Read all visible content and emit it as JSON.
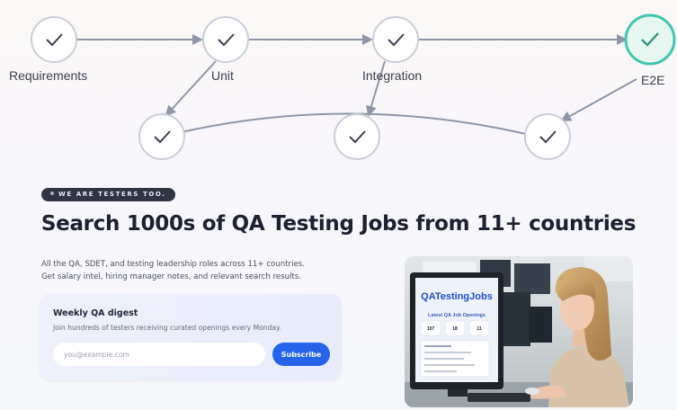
{
  "flow": {
    "stages": [
      {
        "label": "Requirements"
      },
      {
        "label": "Unit"
      },
      {
        "label": "Integration"
      },
      {
        "label": "E2E"
      }
    ]
  },
  "hero": {
    "badge": "WE ARE TESTERS TOO.",
    "headline": "Search 1000s of QA Testing Jobs from 11+ countries",
    "intro_line1": "All the QA, SDET, and testing leadership roles across 11+ countries.",
    "intro_line2": "Get salary intel, hiring manager notes, and relevant search results."
  },
  "newsletter": {
    "title": "Weekly QA digest",
    "subtitle": "Join hundreds of testers receiving curated openings every Monday.",
    "email_placeholder": "you@example.com",
    "subscribe_label": "Subscribe"
  },
  "screen": {
    "logo": "QATestingJobs",
    "heading": "Latest QA Job Openings",
    "stats": [
      "107",
      "18",
      "11"
    ]
  },
  "colors": {
    "accent": "#2563eb",
    "e2e_ring": "#3fc7ae",
    "connector": "#8d95a6"
  }
}
